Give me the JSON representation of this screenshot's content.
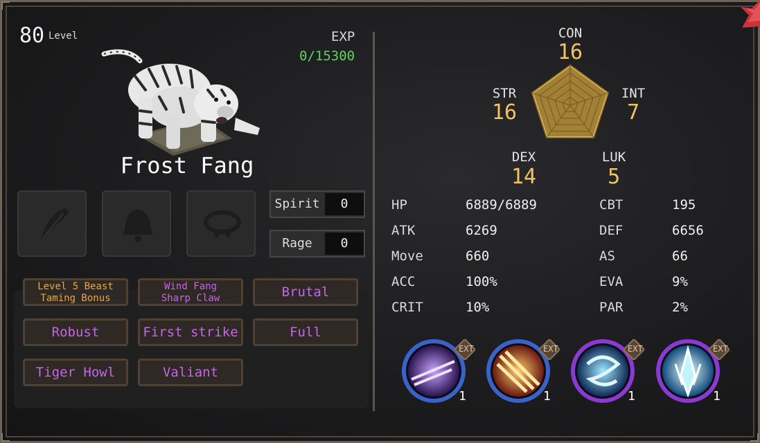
{
  "beast": {
    "level": "80",
    "level_label": "Level",
    "exp_label": "EXP",
    "exp_value": "0/15300",
    "name": "Frost Fang"
  },
  "equipment_slots": [
    {
      "icon": "feather-icon"
    },
    {
      "icon": "bell-icon"
    },
    {
      "icon": "collar-icon"
    }
  ],
  "resources": [
    {
      "label": "Spirit",
      "value": "0"
    },
    {
      "label": "Rage",
      "value": "0"
    }
  ],
  "traits": [
    {
      "label": "Level 5 Beast Taming Bonus",
      "line1": "Level 5 Beast",
      "line2": "Taming Bonus",
      "color": "#e7a83a"
    },
    {
      "label": "Wind Fang Sharp Claw",
      "line1": "Wind Fang",
      "line2": "Sharp Claw",
      "color": "#c565e8"
    },
    {
      "label": "Brutal",
      "color": "#c565e8"
    },
    {
      "label": "Robust",
      "color": "#c565e8"
    },
    {
      "label": "First strike",
      "color": "#c565e8"
    },
    {
      "label": "Full",
      "color": "#c565e8"
    },
    {
      "label": "Tiger Howl",
      "color": "#c565e8"
    },
    {
      "label": "Valiant",
      "color": "#c565e8"
    }
  ],
  "attributes": {
    "con": {
      "label": "CON",
      "value": "16"
    },
    "str": {
      "label": "STR",
      "value": "16"
    },
    "int": {
      "label": "INT",
      "value": "7"
    },
    "dex": {
      "label": "DEX",
      "value": "14"
    },
    "luk": {
      "label": "LUK",
      "value": "5"
    }
  },
  "stats_left": [
    {
      "label": "HP",
      "value": "6889/6889"
    },
    {
      "label": "ATK",
      "value": "6269"
    },
    {
      "label": "Move",
      "value": "660"
    },
    {
      "label": "ACC",
      "value": "100%"
    },
    {
      "label": "CRIT",
      "value": "10%"
    }
  ],
  "stats_right": [
    {
      "label": "CBT",
      "value": "195"
    },
    {
      "label": "DEF",
      "value": "6656"
    },
    {
      "label": "AS",
      "value": "66"
    },
    {
      "label": "EVA",
      "value": "9%"
    },
    {
      "label": "PAR",
      "value": "2%"
    }
  ],
  "skills": [
    {
      "icon": "arrow-strike-skill-icon",
      "ext": "EXT",
      "level": "1",
      "ring": "#3a63c9"
    },
    {
      "icon": "claw-slash-skill-icon",
      "ext": "EXT",
      "level": "1",
      "ring": "#3a63c9"
    },
    {
      "icon": "whirlwind-skill-icon",
      "ext": "EXT",
      "level": "1",
      "ring": "#8a3ad0"
    },
    {
      "icon": "frost-burst-skill-icon",
      "ext": "EXT",
      "level": "1",
      "ring": "#8a3ad0"
    }
  ],
  "colors": {
    "exp": "#5fd35f",
    "attr_value": "#f3c35d",
    "trait_purple": "#c565e8",
    "trait_gold": "#e7a83a"
  }
}
